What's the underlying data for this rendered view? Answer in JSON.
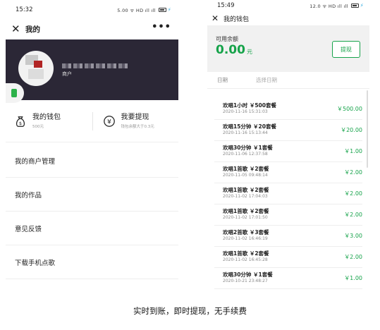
{
  "left": {
    "status": {
      "time": "15:32",
      "icons": "5.00 ᯤ HD ıll ıll"
    },
    "nav": {
      "title": "我的",
      "more": "•••"
    },
    "profile": {
      "role": "商户"
    },
    "wallet": {
      "label": "我的钱包",
      "sub": "500元"
    },
    "withdraw": {
      "label": "我要提现",
      "sub": "钱包余额大于0.3元"
    },
    "menu": [
      "我的商户管理",
      "我的作品",
      "意见反馈",
      "下载手机点歌"
    ]
  },
  "right": {
    "status": {
      "time": "15:49",
      "icons": "12.0 ᯤ HD ıll ıll"
    },
    "nav": {
      "title": "我的钱包"
    },
    "balance": {
      "label": "可用余额",
      "value": "0.00",
      "unit": "元"
    },
    "withdraw_button": "提现",
    "filter": {
      "date_label": "日期",
      "date_picker": "选择日期"
    },
    "records": [
      {
        "title": "欢唱1小时 ￥500套餐",
        "date": "2020-11-16 15:31:03",
        "amount": "￥500.00"
      },
      {
        "title": "欢唱15分钟 ￥20套餐",
        "date": "2020-11-16 15:13:44",
        "amount": "￥20.00"
      },
      {
        "title": "欢唱30分钟 ￥1套餐",
        "date": "2020-11-06 12:37:58",
        "amount": "￥1.00"
      },
      {
        "title": "欢唱1首歌 ￥2套餐",
        "date": "2020-11-05 09:48:14",
        "amount": "￥2.00"
      },
      {
        "title": "欢唱1首歌 ￥2套餐",
        "date": "2020-11-02 17:04:03",
        "amount": "￥2.00"
      },
      {
        "title": "欢唱1首歌 ￥2套餐",
        "date": "2020-11-02 17:01:50",
        "amount": "￥2.00"
      },
      {
        "title": "欢唱2首歌 ￥3套餐",
        "date": "2020-11-02 16:46:19",
        "amount": "￥3.00"
      },
      {
        "title": "欢唱1首歌 ￥2套餐",
        "date": "2020-11-02 16:45:28",
        "amount": "￥2.00"
      },
      {
        "title": "欢唱30分钟 ￥1套餐",
        "date": "2020-10-21 23:48:27",
        "amount": "￥1.00"
      }
    ],
    "partial_record": "欢唱1首歌 ￥2套餐"
  },
  "caption": "实时到账，即时提现，无手续费",
  "colors": {
    "accent_green": "#16a34a",
    "hero_bg": "#2b2736"
  }
}
